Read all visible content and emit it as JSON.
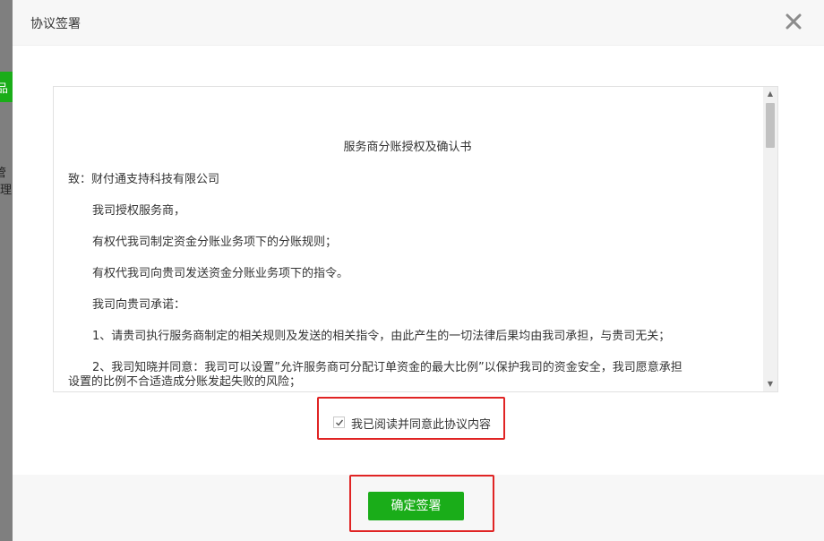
{
  "background": {
    "green_button_fragment": "品",
    "text_fragment": "管理"
  },
  "modal": {
    "title": "协议签署",
    "close_icon": "close-icon"
  },
  "agreement": {
    "title": "服务商分账授权及确认书",
    "paragraphs": [
      "致：财付通支持科技有限公司",
      "我司授权服务商，",
      "有权代我司制定资金分账业务项下的分账规则；",
      "有权代我司向贵司发送资金分账业务项下的指令。",
      "我司向贵司承诺：",
      "1、请贵司执行服务商制定的相关规则及发送的相关指令，由此产生的一切法律后果均由我司承担，与贵司无关；",
      "2、我司知晓并同意：我司可以设置”允许服务商可分配订单资金的最大比例”以保护我司的资金安全，我司愿意承担",
      "设置的比例不合适造成分账发起失败的风险；"
    ]
  },
  "agree": {
    "label": "我已阅读并同意此协议内容",
    "checked": true
  },
  "footer": {
    "confirm_label": "确定签署"
  },
  "colors": {
    "primary_green": "#1aad19",
    "highlight_red": "#e02424"
  }
}
